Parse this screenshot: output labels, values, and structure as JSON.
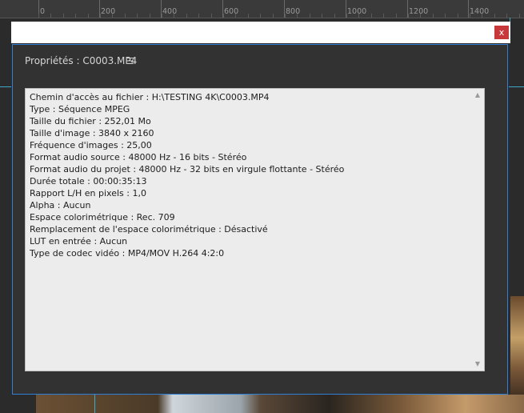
{
  "ruler": {
    "labels": [
      "0",
      "200",
      "400",
      "600",
      "800",
      "1000",
      "1200",
      "1400"
    ]
  },
  "dialog": {
    "title": "Propriétés : C0003.MP4",
    "menu_icon": "☰",
    "close_icon": "x",
    "lines": [
      "Chemin d'accès au fichier : H:\\TESTING 4K\\C0003.MP4",
      "Type : Séquence MPEG",
      "Taille du fichier : 252,01 Mo",
      "Taille d'image : 3840 x 2160",
      "Fréquence d'images : 25,00",
      "Format audio source : 48000 Hz - 16  bits - Stéréo",
      "Format audio du projet : 48000 Hz - 32 bits en virgule flottante - Stéréo",
      "Durée totale : 00:00:35:13",
      "Rapport L/H en pixels : 1,0",
      "Alpha : Aucun",
      "Espace colorimétrique : Rec. 709",
      "Remplacement de l'espace colorimétrique : Désactivé",
      "LUT en entrée : Aucun",
      "Type de codec vidéo : MP4/MOV H.264 4:2:0"
    ]
  }
}
